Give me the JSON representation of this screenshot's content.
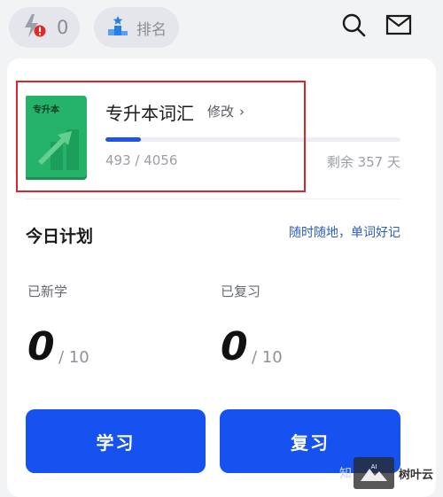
{
  "header": {
    "energy_count": "0",
    "rank_label": "排名",
    "icons": [
      "lightning-alert-icon",
      "podium-icon",
      "search-icon",
      "mail-icon"
    ]
  },
  "vocab_book": {
    "cover_text": "专升本",
    "title": "专升本词汇",
    "edit_label": "修改",
    "learned": 493,
    "total": 4056,
    "progress_fraction": 0.1215,
    "progress_text": "493 / 4056",
    "remaining_text": "剩余 357 天"
  },
  "plan": {
    "title": "今日计划",
    "slogan": "随时随地，单词好记",
    "new_label": "已新学",
    "new_count": "0",
    "new_total": "/ 10",
    "review_label": "已复习",
    "review_count": "0",
    "review_total": "/ 10"
  },
  "actions": {
    "learn_label": "学习",
    "review_label": "复习"
  },
  "colors": {
    "accent": "#1652f0",
    "progress": "#2054e8",
    "book_cover": "#25b36a",
    "highlight": "#d9262a",
    "alert": "#e02a2a"
  },
  "watermark": {
    "prefix": "知",
    "logo_text": "AI",
    "brand": "树叶云"
  }
}
